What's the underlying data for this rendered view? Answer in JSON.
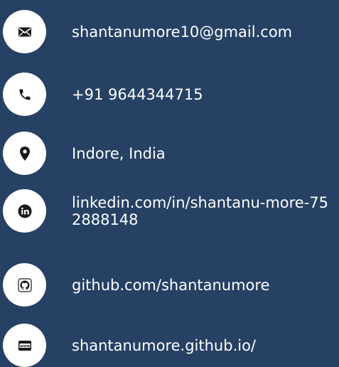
{
  "contacts": {
    "email": {
      "icon": "envelope-icon",
      "text": "shantanumore10@gmail.com"
    },
    "phone": {
      "icon": "phone-icon",
      "text": "+91 9644344715"
    },
    "location": {
      "icon": "location-pin-icon",
      "text": "Indore, India"
    },
    "linkedin": {
      "icon": "linkedin-icon",
      "text": "linkedin.com/in/shantanu-more-752888148"
    },
    "github": {
      "icon": "github-icon",
      "text": "github.com/shantanumore"
    },
    "website": {
      "icon": "www-globe-icon",
      "text": "shantanumore.github.io/"
    }
  },
  "colors": {
    "background": "#264164",
    "icon_circle": "#ffffff",
    "icon_glyph": "#1a1a1a",
    "text": "#ffffff"
  }
}
